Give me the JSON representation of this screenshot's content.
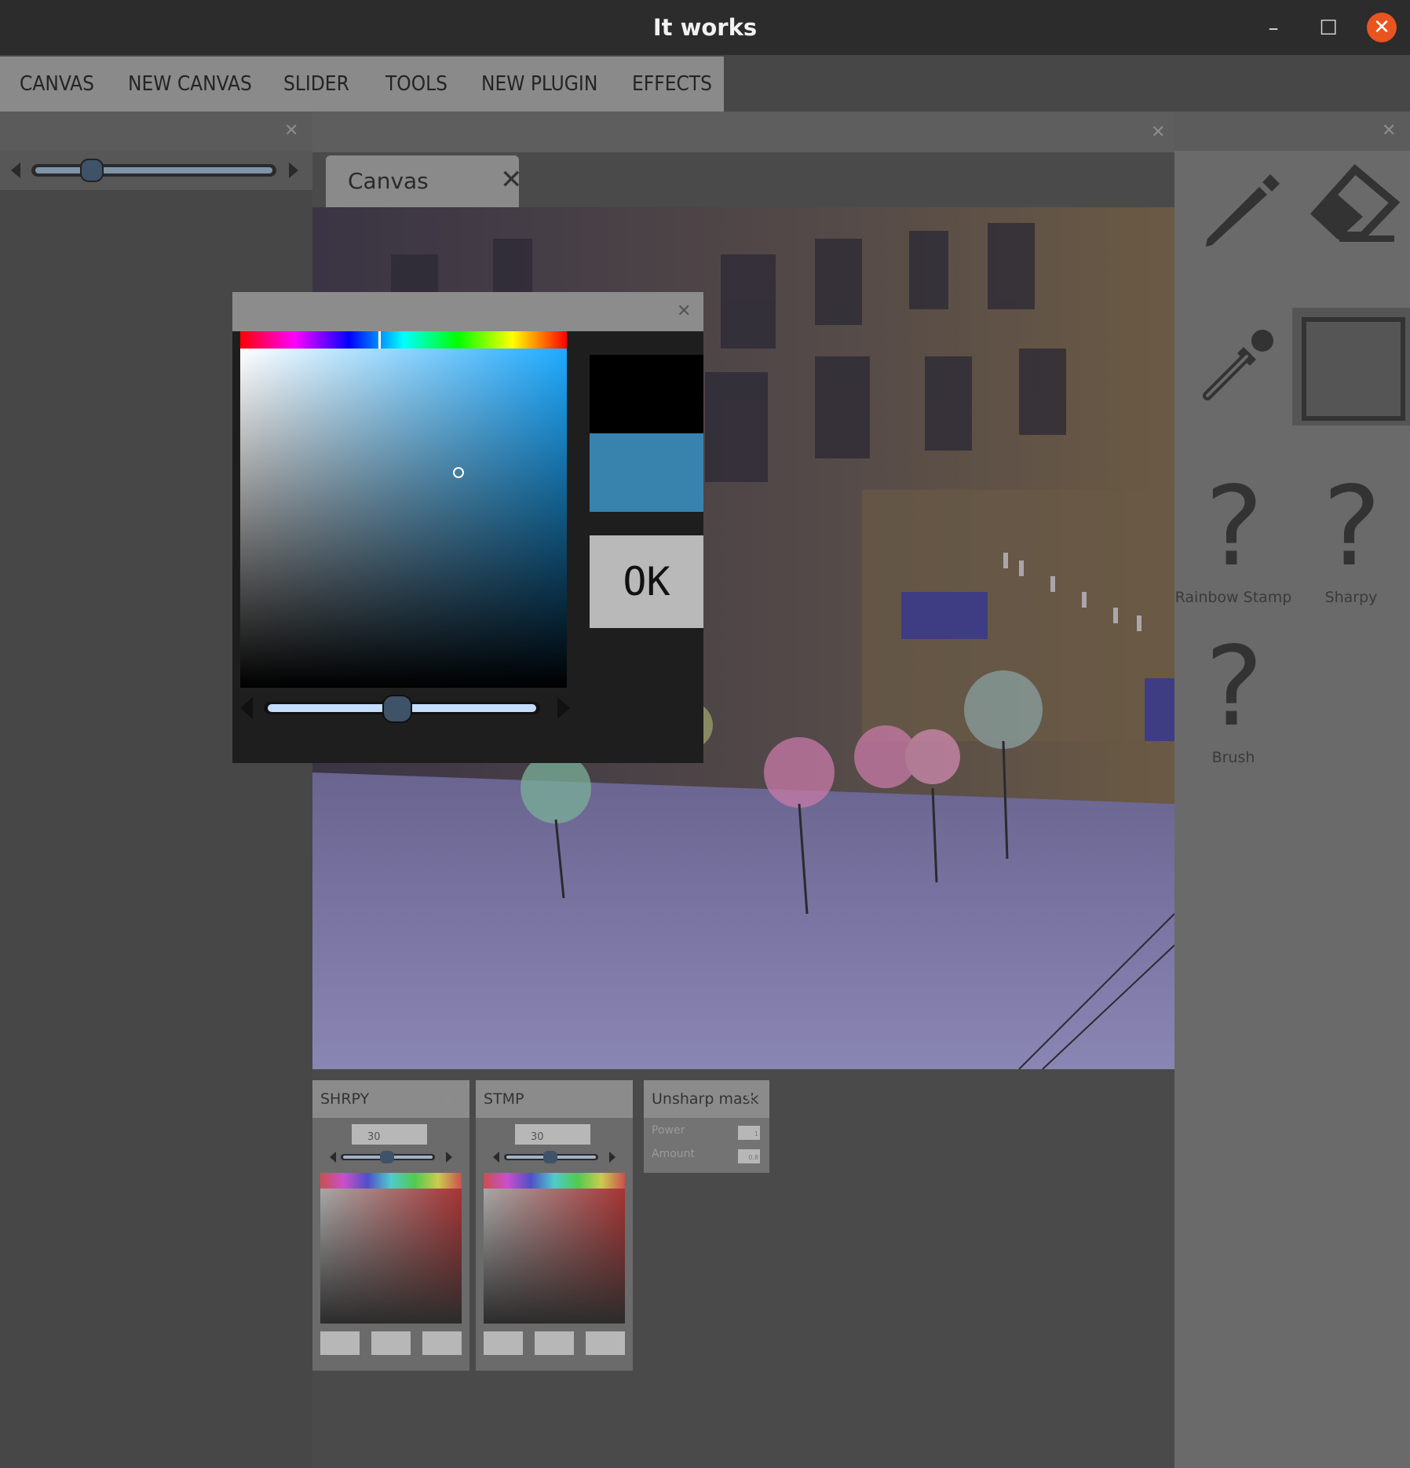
{
  "window": {
    "title": "It works",
    "minimize_glyph": "–",
    "maximize_glyph": "☐",
    "close_glyph": "✕"
  },
  "menu": {
    "items": [
      "CANVAS",
      "NEW CANVAS",
      "SLIDER",
      "TOOLS",
      "NEW PLUGIN",
      "EFFECTS"
    ]
  },
  "canvas_tab": {
    "label": "Canvas"
  },
  "tools": [
    {
      "icon": "pencil-icon"
    },
    {
      "icon": "eraser-icon"
    },
    {
      "icon": "eyedropper-icon"
    },
    {
      "icon": "rectangle-icon",
      "selected": true
    },
    {
      "icon": "question-mark-icon",
      "label": "Rainbow Stamp"
    },
    {
      "icon": "question-mark-icon",
      "label": "Sharpy"
    },
    {
      "icon": "question-mark-icon",
      "label": "Brush"
    }
  ],
  "color_dialog": {
    "ok_label": "OK",
    "previous_color": "#000000",
    "current_color": "#3882ae",
    "hue_color": "#1eaaff",
    "slider_level": 0.43
  },
  "left_slider": {
    "level": 0.25
  },
  "plugins": [
    {
      "title": "SHRPY",
      "value": "30",
      "slider_level": 0.4
    },
    {
      "title": "STMP",
      "value": "30",
      "slider_level": 0.4
    },
    {
      "title": "Unsharp mask",
      "fields": [
        {
          "label": "Power",
          "value": "1"
        },
        {
          "label": "Amount",
          "value": "0.8"
        }
      ]
    }
  ],
  "colors": {
    "accent_close": "#e95420",
    "menu_bg": "#8a8a8a"
  }
}
